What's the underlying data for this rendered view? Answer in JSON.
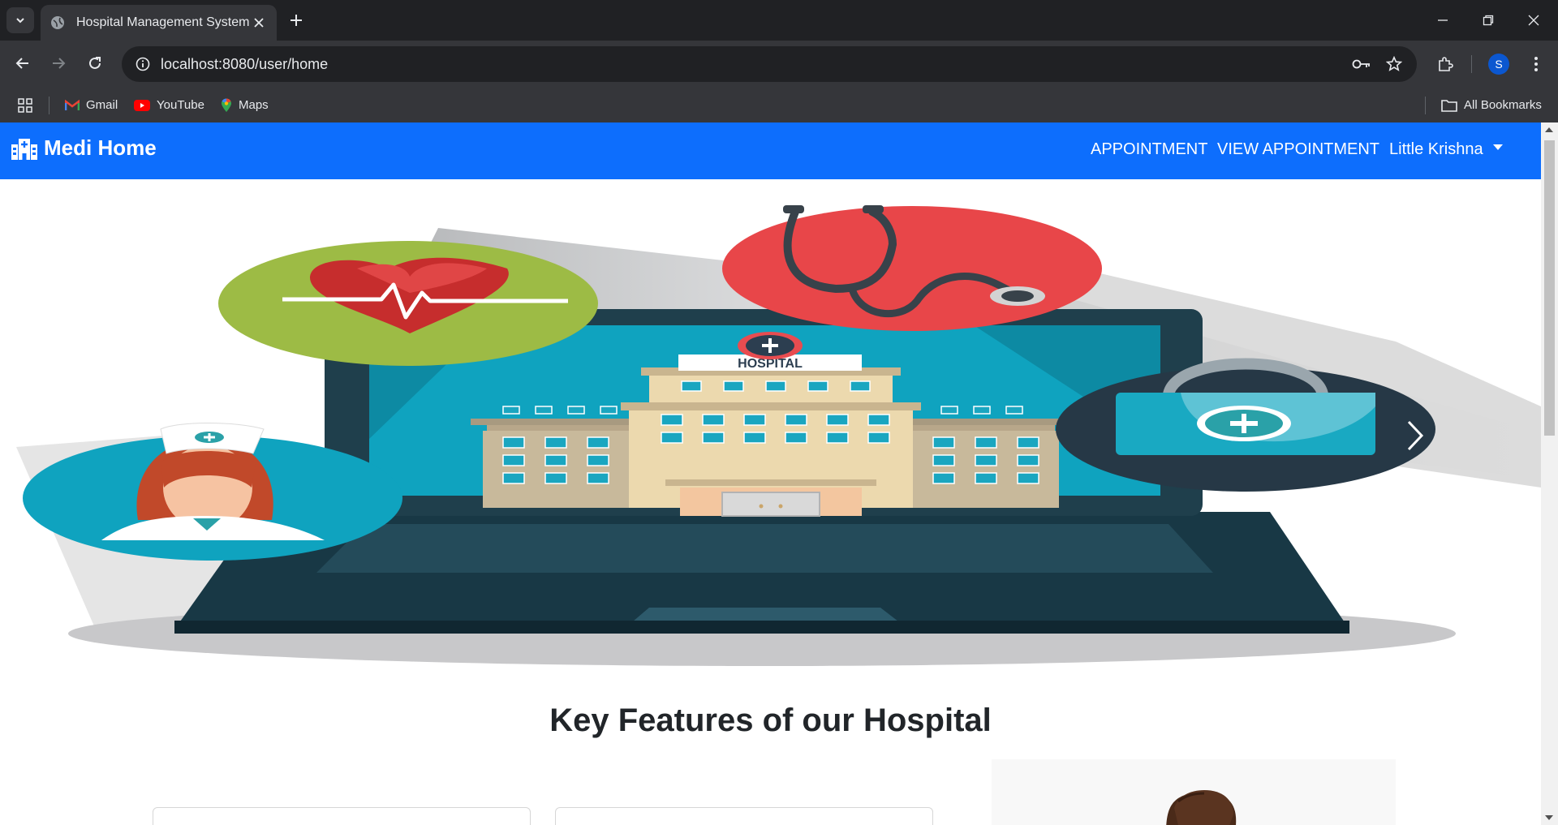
{
  "browser": {
    "tab_title": "Hospital Management System",
    "url": "localhost:8080/user/home",
    "profile_initial": "S",
    "bookmarks": [
      {
        "label": "Gmail"
      },
      {
        "label": "YouTube"
      },
      {
        "label": "Maps"
      }
    ],
    "all_bookmarks_label": "All Bookmarks"
  },
  "navbar": {
    "brand": "Medi Home",
    "links": [
      {
        "label": "APPOINTMENT"
      },
      {
        "label": "VIEW APPOINTMENT"
      }
    ],
    "user_menu_label": "Little Krishna",
    "bg_color": "#0d6efd"
  },
  "hero": {
    "sign_text": "HOSPITAL"
  },
  "features": {
    "title": "Key Features of our Hospital"
  }
}
